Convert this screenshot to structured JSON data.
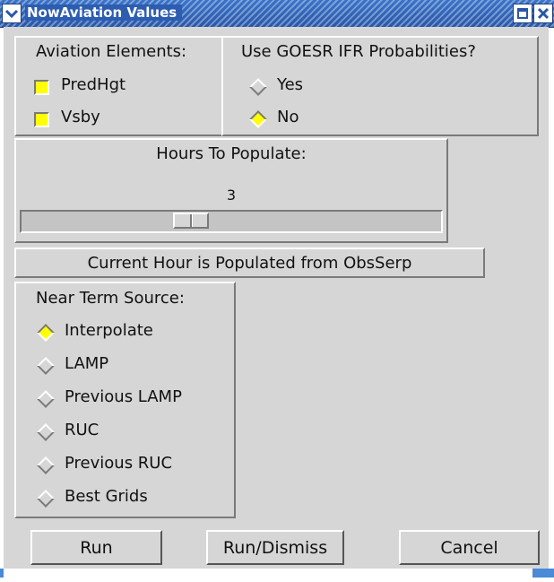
{
  "window": {
    "title": "NowAviation Values"
  },
  "aviation_elements": {
    "heading": "Aviation Elements:",
    "items": [
      {
        "label": "PredHgt",
        "checked": true
      },
      {
        "label": "Vsby",
        "checked": true
      }
    ]
  },
  "goesr": {
    "heading": "Use GOESR IFR Probabilities?",
    "options": [
      {
        "label": "Yes",
        "selected": false
      },
      {
        "label": "No",
        "selected": true
      }
    ]
  },
  "hours": {
    "heading": "Hours To Populate:",
    "value": "3"
  },
  "current_hour_note": "Current Hour is Populated from ObsSerp",
  "near_term": {
    "heading": "Near Term Source:",
    "options": [
      {
        "label": "Interpolate",
        "selected": true
      },
      {
        "label": "LAMP",
        "selected": false
      },
      {
        "label": "Previous LAMP",
        "selected": false
      },
      {
        "label": "RUC",
        "selected": false
      },
      {
        "label": "Previous RUC",
        "selected": false
      },
      {
        "label": "Best Grids",
        "selected": false
      }
    ]
  },
  "buttons": {
    "run": "Run",
    "run_dismiss": "Run/Dismiss",
    "cancel": "Cancel"
  },
  "colors": {
    "title_bar": "#2c5db0",
    "indicator_on": "#ffff00",
    "panel": "#d6d6d6"
  }
}
